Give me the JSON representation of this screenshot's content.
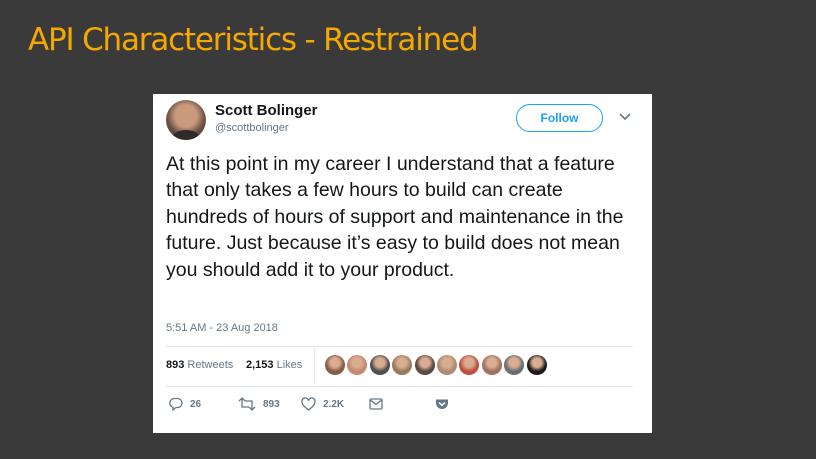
{
  "slide": {
    "title": "API Characteristics - Restrained"
  },
  "tweet": {
    "user_name": "Scott Bolinger",
    "user_handle": "@scottbolinger",
    "follow_label": "Follow",
    "text": "At this point in my career I understand that a feature that only takes a few hours to build can create hundreds of hours of support and maintenance in the future. Just because it’s easy to build does not mean you should add it to your product.",
    "timestamp": "5:51 AM - 23 Aug 2018",
    "retweets_count": "893",
    "retweets_label": "Retweets",
    "likes_count": "2,153",
    "likes_label": "Likes",
    "liker_avatar_colors": [
      "#8a5a4a",
      "#c48a70",
      "#4e4f52",
      "#9a7a5e",
      "#5a4a40",
      "#b08a74",
      "#c0503e",
      "#a07060",
      "#6a6e74",
      "#1c1c1c"
    ],
    "actions": {
      "reply_count": "26",
      "retweet_count": "893",
      "like_count": "2.2K"
    },
    "colors": {
      "accent": "#1da1f2",
      "title": "#f5a800",
      "muted": "#657786"
    }
  }
}
